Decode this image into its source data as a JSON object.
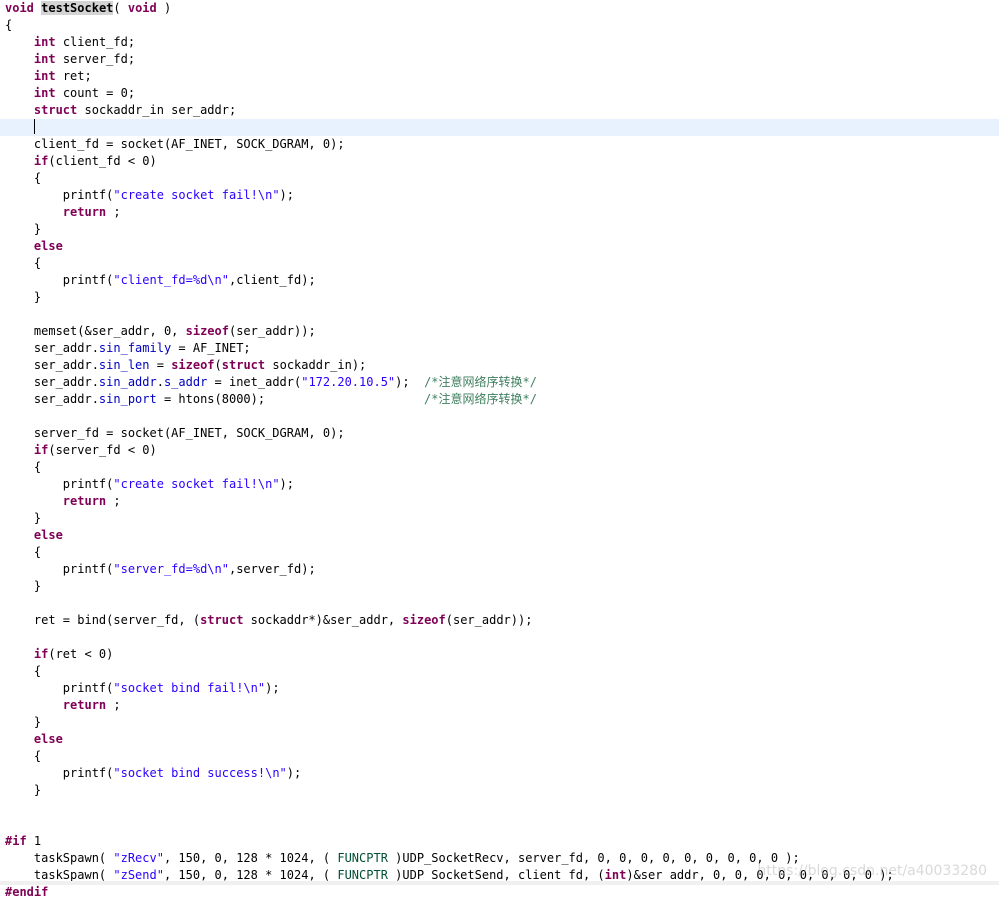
{
  "editor": {
    "current_line_index": 7,
    "lines": [
      [
        [
          "kw",
          "void"
        ],
        [
          "plain",
          " "
        ],
        [
          "hl",
          "testSocket"
        ],
        [
          "plain",
          "( "
        ],
        [
          "kw",
          "void"
        ],
        [
          "plain",
          " )"
        ]
      ],
      [
        [
          "plain",
          "{"
        ]
      ],
      [
        [
          "plain",
          "    "
        ],
        [
          "kw",
          "int"
        ],
        [
          "plain",
          " client_fd;"
        ]
      ],
      [
        [
          "plain",
          "    "
        ],
        [
          "kw",
          "int"
        ],
        [
          "plain",
          " server_fd;"
        ]
      ],
      [
        [
          "plain",
          "    "
        ],
        [
          "kw",
          "int"
        ],
        [
          "plain",
          " ret;"
        ]
      ],
      [
        [
          "plain",
          "    "
        ],
        [
          "kw",
          "int"
        ],
        [
          "plain",
          " count = 0;"
        ]
      ],
      [
        [
          "plain",
          "    "
        ],
        [
          "kw",
          "struct"
        ],
        [
          "plain",
          " sockaddr_in ser_addr;"
        ]
      ],
      [
        [
          "plain",
          "    "
        ],
        [
          "caret",
          ""
        ]
      ],
      [
        [
          "plain",
          "    client_fd = socket(AF_INET, SOCK_DGRAM, 0);"
        ]
      ],
      [
        [
          "plain",
          "    "
        ],
        [
          "kw",
          "if"
        ],
        [
          "plain",
          "(client_fd < 0)"
        ]
      ],
      [
        [
          "plain",
          "    {"
        ]
      ],
      [
        [
          "plain",
          "        printf("
        ],
        [
          "str",
          "\"create socket fail!\\n\""
        ],
        [
          "plain",
          ");"
        ]
      ],
      [
        [
          "plain",
          "        "
        ],
        [
          "kw",
          "return"
        ],
        [
          "plain",
          " ;"
        ]
      ],
      [
        [
          "plain",
          "    }"
        ]
      ],
      [
        [
          "plain",
          "    "
        ],
        [
          "kw",
          "else"
        ]
      ],
      [
        [
          "plain",
          "    {"
        ]
      ],
      [
        [
          "plain",
          "        printf("
        ],
        [
          "str",
          "\"client_fd=%d\\n\""
        ],
        [
          "plain",
          ",client_fd);"
        ]
      ],
      [
        [
          "plain",
          "    }"
        ]
      ],
      [
        [
          "plain",
          ""
        ]
      ],
      [
        [
          "plain",
          "    memset(&ser_addr, 0, "
        ],
        [
          "kw",
          "sizeof"
        ],
        [
          "plain",
          "(ser_addr));"
        ]
      ],
      [
        [
          "plain",
          "    ser_addr."
        ],
        [
          "field",
          "sin_family"
        ],
        [
          "plain",
          " = AF_INET;"
        ]
      ],
      [
        [
          "plain",
          "    ser_addr."
        ],
        [
          "field",
          "sin_len"
        ],
        [
          "plain",
          " = "
        ],
        [
          "kw",
          "sizeof"
        ],
        [
          "plain",
          "("
        ],
        [
          "kw",
          "struct"
        ],
        [
          "plain",
          " sockaddr_in);"
        ]
      ],
      [
        [
          "plain",
          "    ser_addr."
        ],
        [
          "field",
          "sin_addr"
        ],
        [
          "plain",
          "."
        ],
        [
          "field",
          "s_addr"
        ],
        [
          "plain",
          " = inet_addr("
        ],
        [
          "str",
          "\"172.20.10.5\""
        ],
        [
          "plain",
          ");  "
        ],
        [
          "cmt",
          "/*注意网络序转换*/"
        ]
      ],
      [
        [
          "plain",
          "    ser_addr."
        ],
        [
          "field",
          "sin_port"
        ],
        [
          "plain",
          " = htons(8000);                      "
        ],
        [
          "cmt",
          "/*注意网络序转换*/"
        ]
      ],
      [
        [
          "plain",
          ""
        ]
      ],
      [
        [
          "plain",
          "    server_fd = socket(AF_INET, SOCK_DGRAM, 0);"
        ]
      ],
      [
        [
          "plain",
          "    "
        ],
        [
          "kw",
          "if"
        ],
        [
          "plain",
          "(server_fd < 0)"
        ]
      ],
      [
        [
          "plain",
          "    {"
        ]
      ],
      [
        [
          "plain",
          "        printf("
        ],
        [
          "str",
          "\"create socket fail!\\n\""
        ],
        [
          "plain",
          ");"
        ]
      ],
      [
        [
          "plain",
          "        "
        ],
        [
          "kw",
          "return"
        ],
        [
          "plain",
          " ;"
        ]
      ],
      [
        [
          "plain",
          "    }"
        ]
      ],
      [
        [
          "plain",
          "    "
        ],
        [
          "kw",
          "else"
        ]
      ],
      [
        [
          "plain",
          "    {"
        ]
      ],
      [
        [
          "plain",
          "        printf("
        ],
        [
          "str",
          "\"server_fd=%d\\n\""
        ],
        [
          "plain",
          ",server_fd);"
        ]
      ],
      [
        [
          "plain",
          "    }"
        ]
      ],
      [
        [
          "plain",
          ""
        ]
      ],
      [
        [
          "plain",
          "    ret = bind(server_fd, ("
        ],
        [
          "kw",
          "struct"
        ],
        [
          "plain",
          " sockaddr*)&ser_addr, "
        ],
        [
          "kw",
          "sizeof"
        ],
        [
          "plain",
          "(ser_addr));"
        ]
      ],
      [
        [
          "plain",
          ""
        ]
      ],
      [
        [
          "plain",
          "    "
        ],
        [
          "kw",
          "if"
        ],
        [
          "plain",
          "(ret < 0)"
        ]
      ],
      [
        [
          "plain",
          "    {"
        ]
      ],
      [
        [
          "plain",
          "        printf("
        ],
        [
          "str",
          "\"socket bind fail!\\n\""
        ],
        [
          "plain",
          ");"
        ]
      ],
      [
        [
          "plain",
          "        "
        ],
        [
          "kw",
          "return"
        ],
        [
          "plain",
          " ;"
        ]
      ],
      [
        [
          "plain",
          "    }"
        ]
      ],
      [
        [
          "plain",
          "    "
        ],
        [
          "kw",
          "else"
        ]
      ],
      [
        [
          "plain",
          "    {"
        ]
      ],
      [
        [
          "plain",
          "        printf("
        ],
        [
          "str",
          "\"socket bind success!\\n\""
        ],
        [
          "plain",
          ");"
        ]
      ],
      [
        [
          "plain",
          "    }"
        ]
      ],
      [
        [
          "plain",
          ""
        ]
      ],
      [
        [
          "plain",
          ""
        ]
      ],
      [
        [
          "pp",
          "#if"
        ],
        [
          "plain",
          " 1"
        ]
      ],
      [
        [
          "plain",
          "    taskSpawn( "
        ],
        [
          "str",
          "\"zRecv\""
        ],
        [
          "plain",
          ", 150, 0, 128 * 1024, ( "
        ],
        [
          "macro",
          "FUNCPTR"
        ],
        [
          "plain",
          " )UDP_SocketRecv, server_fd, 0, 0, 0, 0, 0, 0, 0, 0, 0 );"
        ]
      ],
      [
        [
          "plain",
          "    taskSpawn( "
        ],
        [
          "str",
          "\"zSend\""
        ],
        [
          "plain",
          ", 150, 0, 128 * 1024, ( "
        ],
        [
          "macro",
          "FUNCPTR"
        ],
        [
          "plain",
          " )UDP_SocketSend, client_fd, ("
        ],
        [
          "kw",
          "int"
        ],
        [
          "plain",
          ")&ser_addr, 0, 0, 0, 0, 0, 0, 0, 0 );"
        ]
      ],
      [
        [
          "pp",
          "#endif"
        ]
      ]
    ]
  },
  "watermark": "https://blog.csdn.net/a40033280",
  "colors": {
    "keyword": "#7f0055",
    "string": "#2a00ff",
    "comment": "#3f7f5f",
    "field": "#0000c0",
    "macro": "#005032",
    "current_line_bg": "#e8f2fe",
    "selection_highlight": "#d4d4d4"
  }
}
